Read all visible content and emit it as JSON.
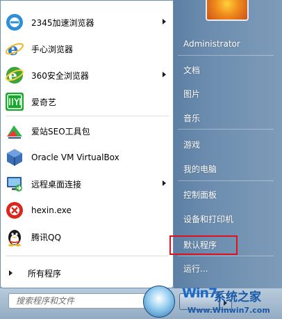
{
  "pinned": [
    {
      "label": "2345加速浏览器",
      "icon": "browser-2345-icon",
      "has_submenu": true
    },
    {
      "label": "手心浏览器",
      "icon": "ie-browser-icon",
      "has_submenu": false
    },
    {
      "label": "360安全浏览器",
      "icon": "browser-360-icon",
      "has_submenu": true
    },
    {
      "label": "爱奇艺",
      "icon": "iqiyi-icon",
      "has_submenu": false
    }
  ],
  "recent": [
    {
      "label": "爱站SEO工具包",
      "icon": "seo-toolkit-icon",
      "has_submenu": false
    },
    {
      "label": "Oracle VM VirtualBox",
      "icon": "virtualbox-icon",
      "has_submenu": false
    },
    {
      "label": "远程桌面连接",
      "icon": "remote-desktop-icon",
      "has_submenu": true
    },
    {
      "label": "hexin.exe",
      "icon": "hexin-icon",
      "has_submenu": false
    },
    {
      "label": "腾讯QQ",
      "icon": "qq-penguin-icon",
      "has_submenu": false
    }
  ],
  "all_programs": "所有程序",
  "search_placeholder": "搜索程序和文件",
  "right": {
    "user": "Administrator",
    "documents": "文档",
    "pictures": "图片",
    "music": "音乐",
    "games": "游戏",
    "computer": "我的电脑",
    "control_panel": "控制面板",
    "devices": "设备和打印机",
    "default_programs": "默认程序",
    "run": "运行..."
  },
  "watermark": {
    "logo": "Win7",
    "cn": "系统之家",
    "url": "Www.Winwin7.com"
  },
  "colors": {
    "highlight_border": "#e0101c",
    "right_pane": "#6b8cae"
  }
}
